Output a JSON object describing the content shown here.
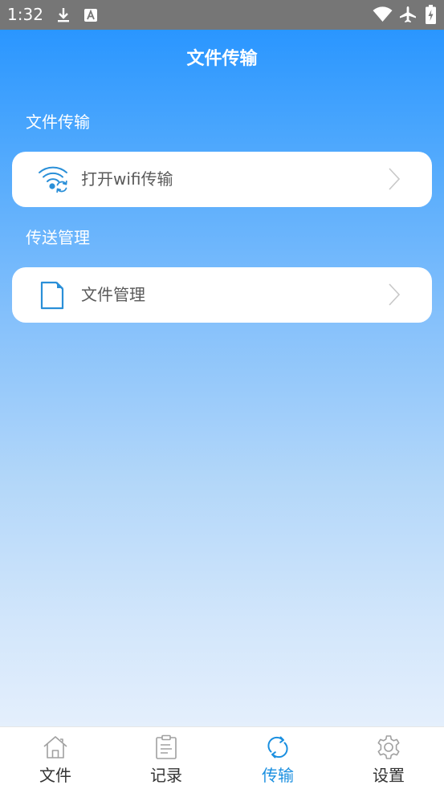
{
  "status_bar": {
    "time": "1:32",
    "left_icons": [
      "download-icon",
      "a-notification-icon"
    ],
    "right_icons": [
      "wifi-icon",
      "airplane-mode-icon",
      "battery-charging-icon"
    ]
  },
  "header": {
    "title": "文件传输"
  },
  "sections": [
    {
      "label": "文件传输",
      "items": [
        {
          "label": "打开wifi传输",
          "icon": "wifi-transfer-icon",
          "trailing_icon": "chevron-right-icon"
        }
      ]
    },
    {
      "label": "传送管理",
      "items": [
        {
          "label": "文件管理",
          "icon": "file-icon",
          "trailing_icon": "chevron-right-icon"
        }
      ]
    }
  ],
  "bottom_nav": {
    "items": [
      {
        "label": "文件",
        "icon": "home-icon",
        "active": false
      },
      {
        "label": "记录",
        "icon": "clipboard-icon",
        "active": false
      },
      {
        "label": "传输",
        "icon": "sync-icon",
        "active": true
      },
      {
        "label": "设置",
        "icon": "gear-icon",
        "active": false
      }
    ]
  },
  "colors": {
    "status_bar": "#767676",
    "gradient_top": "#2a96ff",
    "gradient_bottom": "#e4effc",
    "accent": "#1a8fe0",
    "item_text": "#5a5a5a",
    "nav_inactive_icon": "#a0a0a0"
  }
}
